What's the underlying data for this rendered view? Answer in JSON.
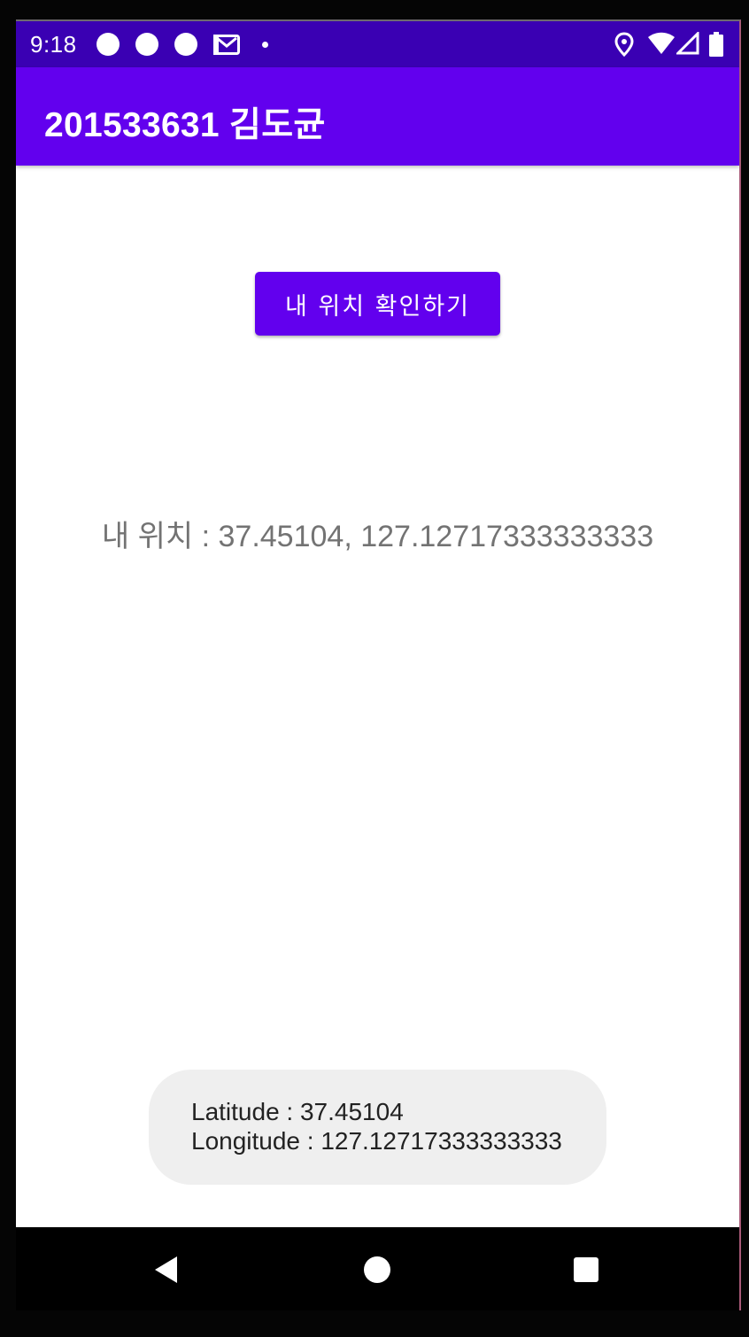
{
  "status_bar": {
    "time": "9:18",
    "colors": {
      "background": "#3a00b3"
    },
    "notification_icons": [
      "circle-icon",
      "circle-icon",
      "circle-icon",
      "gmail-icon",
      "dot-icon"
    ],
    "system_icons": [
      "location-icon",
      "wifi-icon",
      "signal-icon",
      "battery-icon"
    ]
  },
  "app_bar": {
    "title": "201533631 김도균",
    "colors": {
      "background": "#6200ee"
    }
  },
  "main": {
    "check_location_button": "내 위치 확인하기",
    "location_label": "내 위치 : ",
    "latitude": "37.45104",
    "separator": ", ",
    "longitude": "127.12717333333333"
  },
  "toast": {
    "latitude_label": "Latitude : ",
    "latitude": "37.45104",
    "longitude_label": "Longitude : ",
    "longitude": "127.12717333333333"
  },
  "nav_bar": {
    "buttons": [
      "back-icon",
      "home-icon",
      "recents-icon"
    ]
  }
}
